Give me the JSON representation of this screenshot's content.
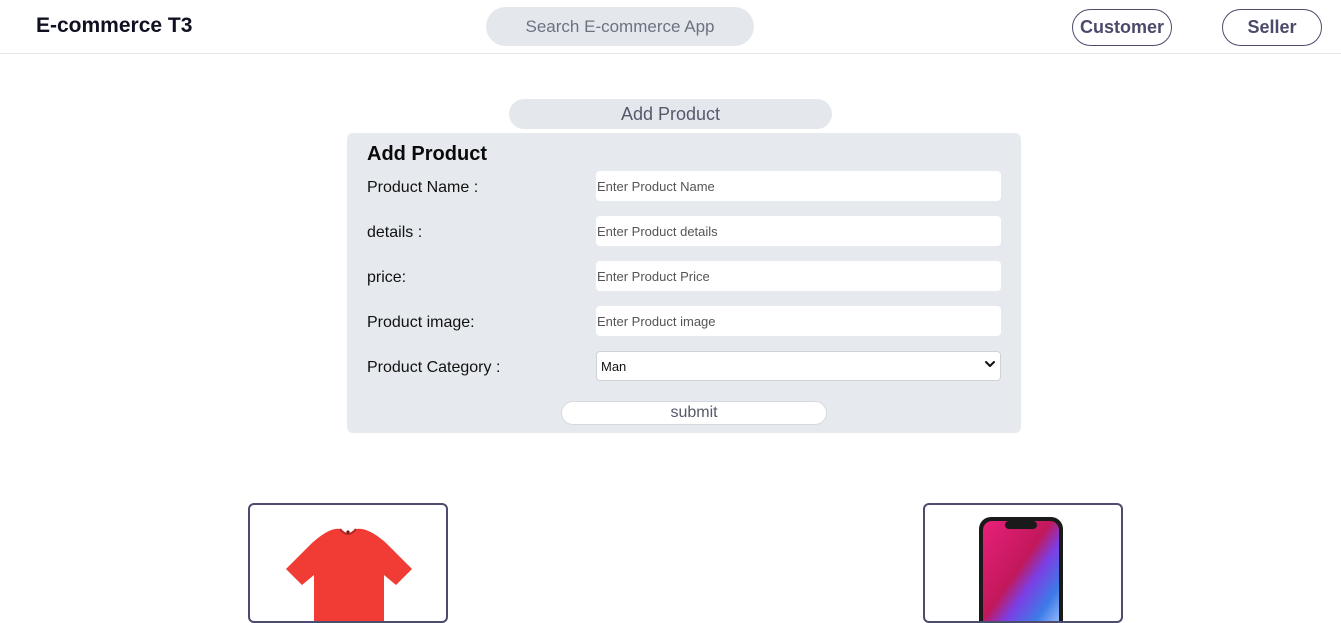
{
  "header": {
    "brand": "E-commerce T3",
    "search_placeholder": "Search E-commerce App",
    "customer_label": "Customer",
    "seller_label": "Seller"
  },
  "add_product_toggle": "Add Product",
  "form": {
    "title": "Add Product",
    "fields": [
      {
        "label": "Product Name :",
        "placeholder": "Enter Product Name"
      },
      {
        "label": "details :",
        "placeholder": "Enter Product details"
      },
      {
        "label": "price:",
        "placeholder": "Enter Product Price"
      },
      {
        "label": "Product image:",
        "placeholder": "Enter Product image"
      }
    ],
    "category": {
      "label": "Product Category :",
      "selected": "Man"
    },
    "submit_label": "submit"
  },
  "products": [
    {
      "image_icon": "tshirt-icon",
      "color": "#f03c34"
    },
    {
      "image_icon": "smartphone-icon",
      "color": "#1a1a1a"
    }
  ],
  "colors": {
    "panel_bg": "#e6eaee",
    "accent_border": "#4c4c6e"
  }
}
